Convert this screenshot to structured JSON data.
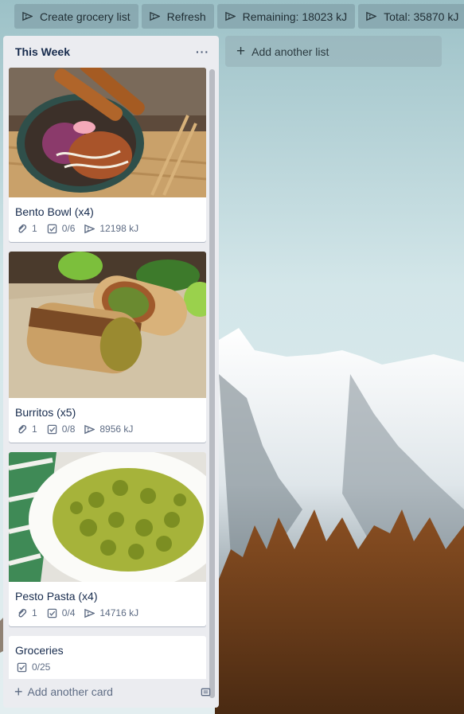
{
  "toolbar": {
    "create_label": "Create grocery list",
    "refresh_label": "Refresh",
    "remaining_label": "Remaining: 18023 kJ",
    "total_label": "Total: 35870 kJ"
  },
  "list": {
    "title": "This Week",
    "menu": "···",
    "add_card_label": "Add another card",
    "cards": [
      {
        "title": "Bento Bowl (x4)",
        "attachments": "1",
        "checklist": "0/6",
        "energy": "12198 kJ"
      },
      {
        "title": "Burritos (x5)",
        "attachments": "1",
        "checklist": "0/8",
        "energy": "8956 kJ"
      },
      {
        "title": "Pesto Pasta (x4)",
        "attachments": "1",
        "checklist": "0/4",
        "energy": "14716 kJ"
      },
      {
        "title": "Groceries",
        "checklist": "0/25"
      }
    ]
  },
  "add_list_label": "Add another list",
  "colors": {
    "list_bg": "#ebecf0",
    "text": "#172b4d",
    "muted": "#5e6c84"
  }
}
